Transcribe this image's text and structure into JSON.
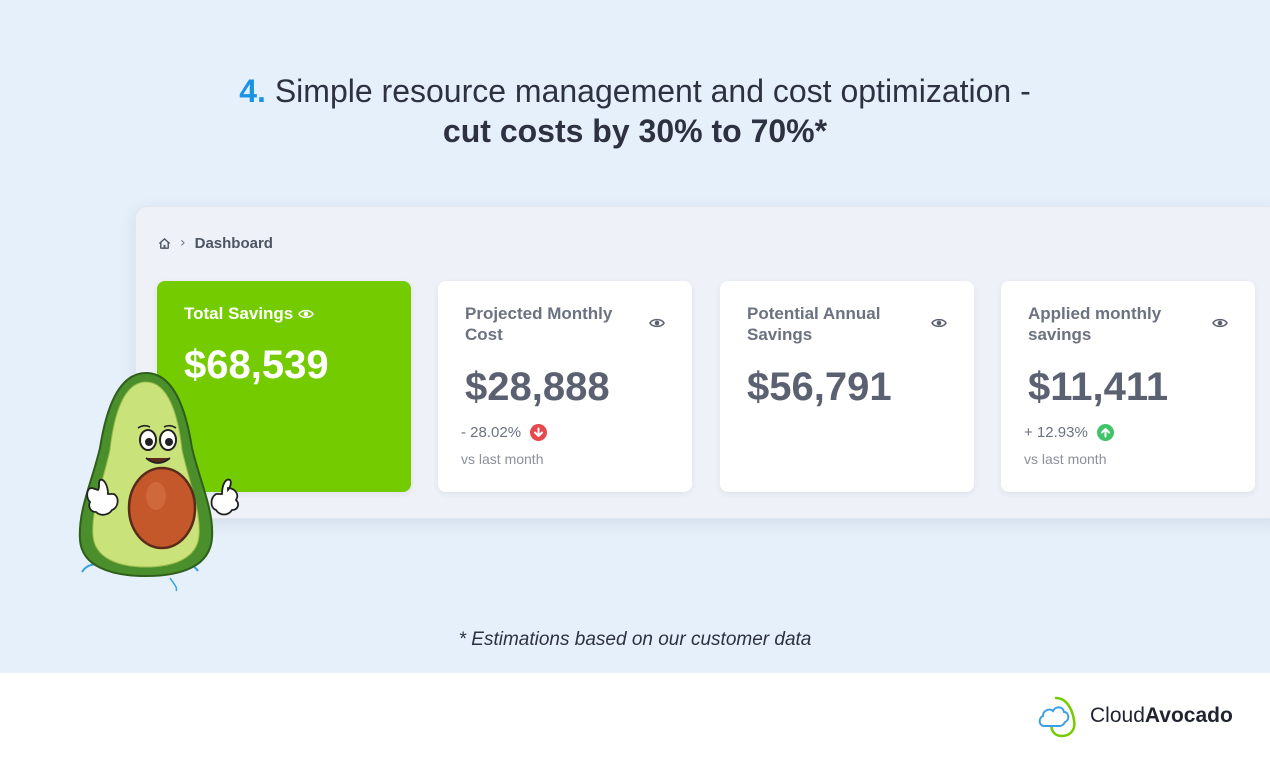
{
  "heading": {
    "number": "4.",
    "line1": "Simple resource management and cost optimization -",
    "line2": "cut costs by 30% to 70%*"
  },
  "breadcrumb": {
    "home_icon": "home-icon",
    "separator_icon": "chevron-right-icon",
    "label": "Dashboard"
  },
  "cards": {
    "total_savings": {
      "title": "Total Savings",
      "value": "$68,539",
      "icon": "eye-icon",
      "color": "#74cc00"
    },
    "projected_monthly_cost": {
      "title": "Projected Monthly Cost",
      "value": "$28,888",
      "change": "- 28.02%",
      "trend": "down",
      "trend_color": "#e5484d",
      "sub": "vs last month",
      "icon": "eye-icon"
    },
    "potential_annual_savings": {
      "title": "Potential Annual Savings",
      "value": "$56,791",
      "icon": "eye-icon"
    },
    "applied_monthly_savings": {
      "title": "Applied monthly savings",
      "value": "$11,411",
      "change": "+ 12.93%",
      "trend": "up",
      "trend_color": "#3fc46a",
      "sub": "vs last month",
      "icon": "eye-icon"
    }
  },
  "mascot": "avocado-mascot",
  "footnote": "* Estimations based on our customer data",
  "logo": {
    "part1": "Cloud",
    "part2": "Avocado",
    "accent": "#74cc00"
  }
}
